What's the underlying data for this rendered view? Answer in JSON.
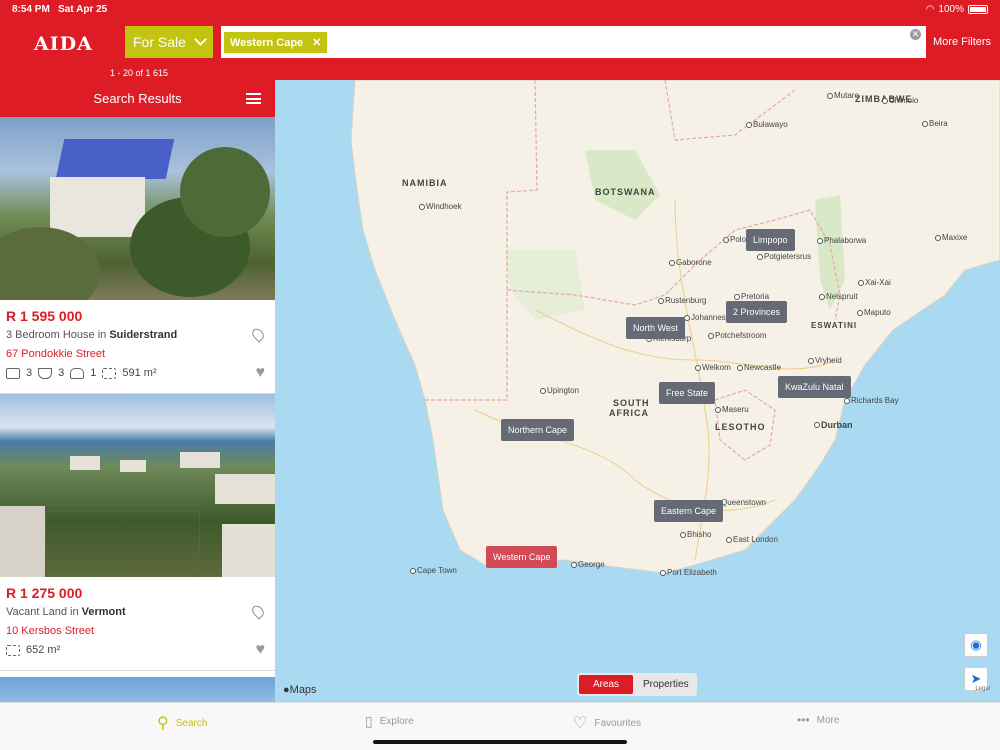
{
  "status": {
    "time": "8:54 PM",
    "date": "Sat Apr 25",
    "battery": "100%"
  },
  "header": {
    "logo": "AIDA",
    "sale_filter": "For Sale",
    "search_chip": "Western Cape",
    "more_filters": "More Filters",
    "results_count": "1 - 20 of 1 615"
  },
  "sidebar": {
    "title": "Search Results",
    "listings": [
      {
        "price": "R 1 595 000",
        "type": "3 Bedroom House in",
        "area": "Suiderstrand",
        "street": "67 Pondokkie Street",
        "beds": "3",
        "baths": "3",
        "garages": "1",
        "size": "591 m²"
      },
      {
        "price": "R 1 275 000",
        "type": "Vacant Land in",
        "area": "Vermont",
        "street": "10 Kersbos Street",
        "size": "652 m²"
      }
    ]
  },
  "map": {
    "countries": [
      "ZIMBABWE",
      "NAMIBIA",
      "BOTSWANA",
      "SOUTH",
      "AFRICA",
      "LESOTHO",
      "ESWATINI"
    ],
    "cities": [
      "Mutare",
      "Chimoio",
      "Bulawayo",
      "Beira",
      "Windhoek",
      "Polokwane",
      "Phalaborwa",
      "Maxixe",
      "Gaborone",
      "Potgietersrus",
      "Xai-Xai",
      "Rustenburg",
      "Pretoria",
      "Nelspruit",
      "Johannesburg",
      "Maputo",
      "Klerksdorp",
      "Potchefstroom",
      "Vryheid",
      "Welkom",
      "Newcastle",
      "Upington",
      "Maseru",
      "Richards Bay",
      "Durban",
      "Queenstown",
      "Bhisho",
      "East London",
      "Cape Town",
      "George",
      "Port Elizabeth"
    ],
    "tags": [
      "Limpopo",
      "2 Provinces",
      "North West",
      "Free State",
      "KwaZulu Natal",
      "Northern Cape",
      "Eastern Cape",
      "Western Cape"
    ],
    "segment": {
      "areas": "Areas",
      "properties": "Properties"
    },
    "maps_brand": "Maps",
    "legal": "Legal"
  },
  "tabs": [
    "Search",
    "Explore",
    "Favourites",
    "More"
  ]
}
